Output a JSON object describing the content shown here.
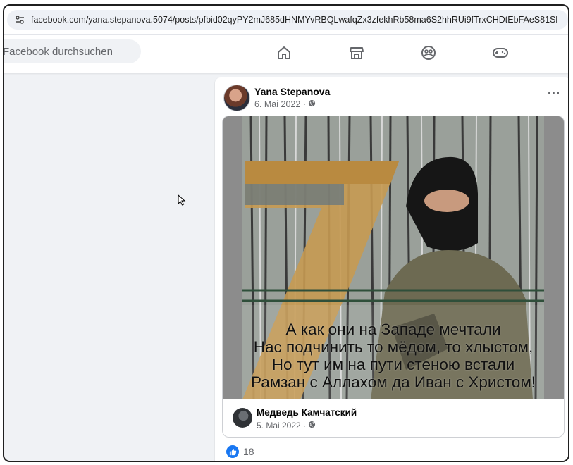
{
  "browser": {
    "url": "facebook.com/yana.stepanova.5074/posts/pfbid02qyPY2mJ685dHNMYvRBQLwafqZx3zfekhRb58ma6S2hhRUi9fTrxCHDtEbFAeS81Sl",
    "site_icon": "site-settings-icon"
  },
  "nav": {
    "search_placeholder": "Facebook durchsuchen",
    "icons": [
      "home-icon",
      "marketplace-icon",
      "groups-icon",
      "gaming-icon"
    ]
  },
  "post": {
    "author": "Yana Stepanova",
    "date": "6. Mai 2022 ·",
    "privacy_icon": "globe-icon",
    "more_label": "···",
    "image_text": [
      "А как они на Западе мечтали",
      "Нас подчинить то мёдом, то хлыстом,",
      "Но тут им на пути стеною встали",
      "Рамзан с  Аллахом да Иван с Христом!"
    ],
    "shared_author": "Медведь Камчатский",
    "shared_date": "5. Mai 2022 ·",
    "like_count": "18"
  },
  "colors": {
    "fb_blue": "#1877f2",
    "background": "#f0f2f5",
    "secondary_text": "#65676b"
  }
}
